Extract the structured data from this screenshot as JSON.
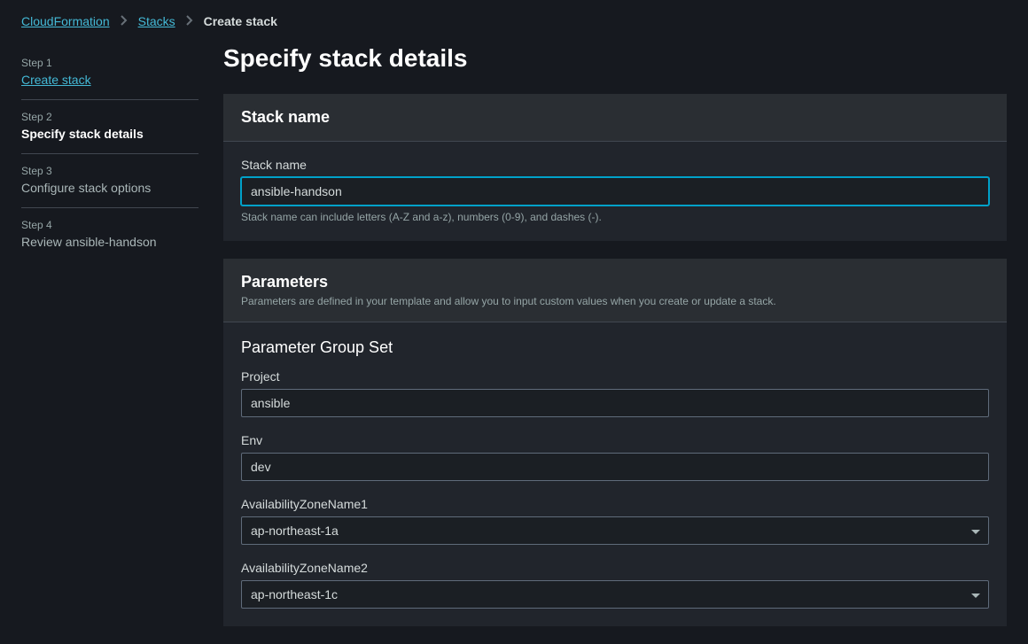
{
  "breadcrumb": {
    "root": "CloudFormation",
    "stacks": "Stacks",
    "current": "Create stack"
  },
  "steps": [
    {
      "num": "Step 1",
      "label": "Create stack",
      "state": "link"
    },
    {
      "num": "Step 2",
      "label": "Specify stack details",
      "state": "active"
    },
    {
      "num": "Step 3",
      "label": "Configure stack options",
      "state": ""
    },
    {
      "num": "Step 4",
      "label": "Review ansible-handson",
      "state": ""
    }
  ],
  "page_title": "Specify stack details",
  "stack_name_panel": {
    "title": "Stack name",
    "field_label": "Stack name",
    "value": "ansible-handson",
    "hint": "Stack name can include letters (A-Z and a-z), numbers (0-9), and dashes (-)."
  },
  "parameters_panel": {
    "title": "Parameters",
    "subtitle": "Parameters are defined in your template and allow you to input custom values when you create or update a stack.",
    "group_title": "Parameter Group Set",
    "fields": {
      "project_label": "Project",
      "project_value": "ansible",
      "env_label": "Env",
      "env_value": "dev",
      "az1_label": "AvailabilityZoneName1",
      "az1_value": "ap-northeast-1a",
      "az2_label": "AvailabilityZoneName2",
      "az2_value": "ap-northeast-1c"
    }
  }
}
